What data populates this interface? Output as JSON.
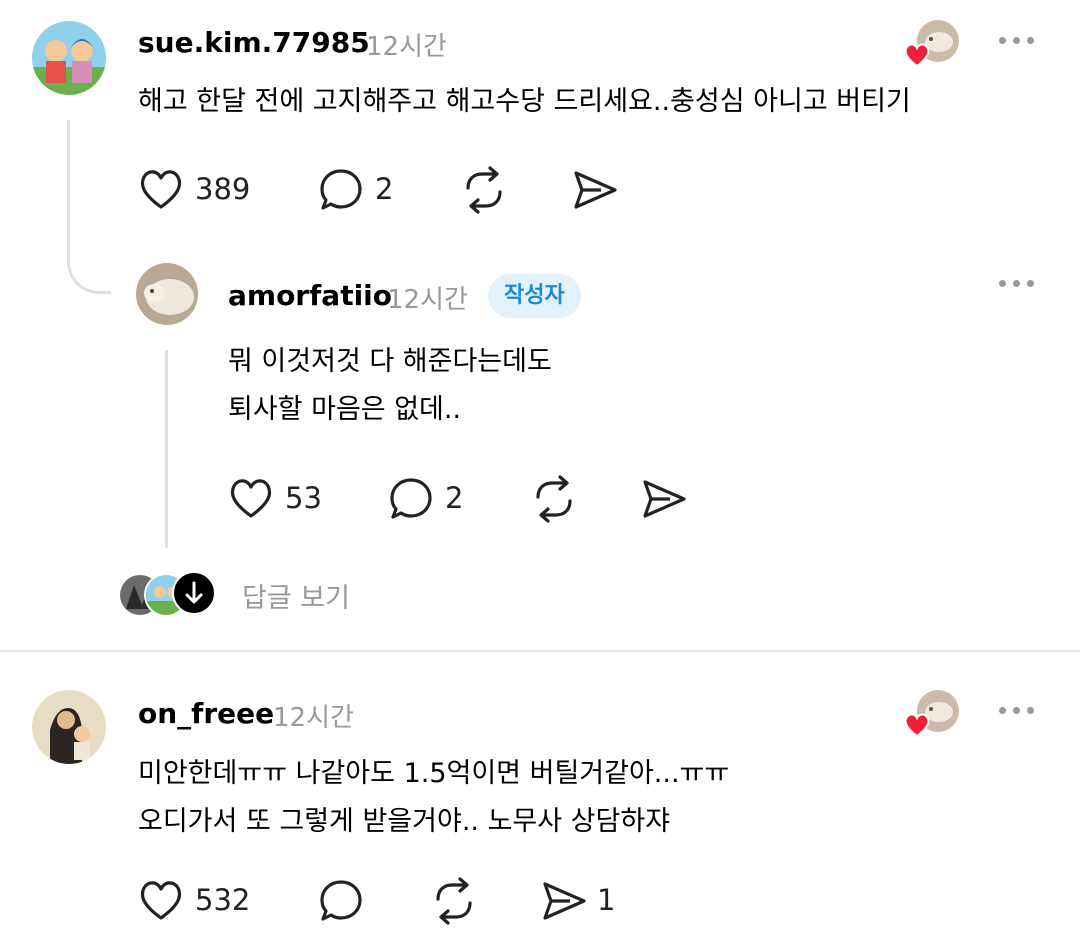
{
  "posts": [
    {
      "username": "sue.kim.77985",
      "time": "12시간",
      "lines": [
        "해고 한달 전에 고지해주고 해고수당 드리세요..충성심 아니고 버티기"
      ],
      "likes": "389",
      "comments": "2",
      "reposts": "",
      "shares": "",
      "liked_by_author": true
    },
    {
      "username": "amorfatiio",
      "time": "12시간",
      "badge": "작성자",
      "lines": [
        "뭐 이것저것 다 해준다는데도",
        "퇴사할 마음은 없데.."
      ],
      "likes": "53",
      "comments": "2",
      "reposts": "",
      "shares": ""
    },
    {
      "username": "on_freee",
      "time": "12시간",
      "lines": [
        "미안한데ㅠㅠ 나같아도 1.5억이면 버틸거같아...ㅠㅠ",
        "오디가서 또 그렇게 받을거야.. 노무사 상담하쟈"
      ],
      "likes": "532",
      "comments": "",
      "reposts": "",
      "shares": "1",
      "liked_by_author": true
    }
  ],
  "view_replies_label": "답글 보기",
  "icons": {
    "like": "heart-outline-icon",
    "comment": "speech-bubble-icon",
    "repost": "repost-icon",
    "share": "send-icon",
    "more": "more-horizontal-icon"
  },
  "colors": {
    "heart_red": "#f0203a",
    "muted": "#999999",
    "badge_bg": "#e3f1fd",
    "badge_text": "#1c8ad7",
    "thread_line": "#e0e0e0"
  }
}
